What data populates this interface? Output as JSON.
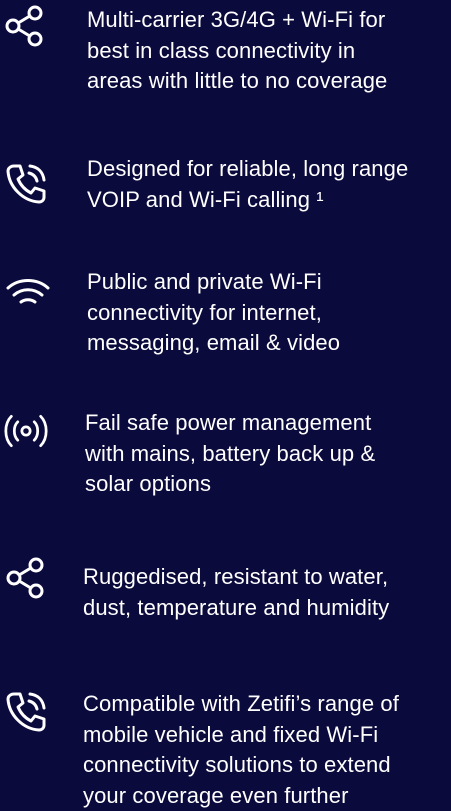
{
  "colors": {
    "background": "#0b0a3c",
    "text": "#ffffff"
  },
  "features": [
    {
      "icon": "share-icon",
      "lines": [
        "Multi-carrier 3G/4G + Wi-Fi for",
        "best in class connectivity in",
        "areas with little to no coverage"
      ]
    },
    {
      "icon": "phone-call-icon",
      "lines": [
        "Designed for reliable, long range",
        "VOIP and Wi-Fi calling ¹"
      ]
    },
    {
      "icon": "wifi-icon",
      "lines": [
        "Public and private Wi-Fi",
        "connectivity for internet,",
        "messaging, email & video"
      ]
    },
    {
      "icon": "broadcast-icon",
      "lines": [
        "Fail safe power management",
        "with mains, battery back up &",
        "solar options"
      ]
    },
    {
      "icon": "share-icon",
      "lines": [
        "Ruggedised, resistant to water,",
        "dust, temperature and humidity"
      ]
    },
    {
      "icon": "phone-call-icon",
      "lines": [
        "Compatible with Zetifi’s range of",
        "mobile vehicle and fixed Wi-Fi",
        "connectivity solutions to extend",
        "your coverage even further"
      ]
    }
  ]
}
